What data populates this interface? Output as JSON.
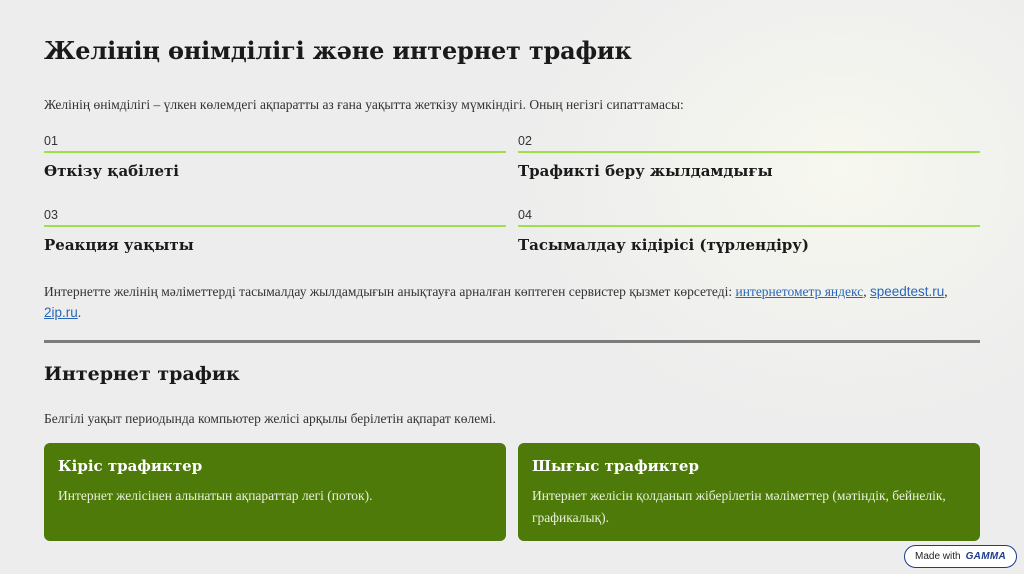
{
  "title": "Желінің өнімділігі және интернет трафик",
  "intro": "Желінің өнімділігі – үлкен көлемдегі ақпаратты аз ғана уақытта жеткізу мүмкіндігі. Оның негізгі сипаттамасы:",
  "features": [
    {
      "num": "01",
      "label": "Өткізу қабілеті"
    },
    {
      "num": "02",
      "label": "Трафикті беру жылдамдығы"
    },
    {
      "num": "03",
      "label": "Реакция уақыты"
    },
    {
      "num": "04",
      "label": "Тасымалдау кідірісі (түрлендіру)"
    }
  ],
  "services": {
    "text": "Интернетте желінің мәліметтерді тасымалдау жылдамдығын анықтауға арналған көптеген сервистер қызмет көрсетеді: ",
    "links": [
      "интернетометр яндекс",
      "speedtest.ru",
      "2ip.ru"
    ],
    "sep": ", ",
    "end": "."
  },
  "section": {
    "title": "Интернет трафик",
    "desc": "Белгілі уақыт периодында компьютер желісі арқылы берілетін ақпарат көлемі."
  },
  "cards": [
    {
      "title": "Кіріс трафиктер",
      "text": "Интернет желісінен алынатын ақпараттар легі (поток)."
    },
    {
      "title": "Шығыс трафиктер",
      "text": "Интернет желісін қолданып жіберілетін мәліметтер (мәтіндік, бейнелік, графикалық)."
    }
  ],
  "badge": {
    "made": "Made with",
    "brand": "GAMMA"
  },
  "colors": {
    "accent_line": "#9fe04a",
    "card_bg": "#4e7a0a",
    "link": "#2a66b8"
  }
}
